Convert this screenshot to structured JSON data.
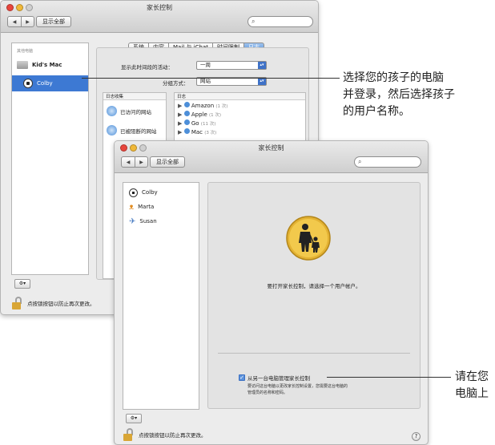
{
  "back_window": {
    "title": "家长控制",
    "show_all": "显示全部",
    "sidebar_header": "其他电脑",
    "sidebar_items": [
      "Kid's Mac",
      "Colby"
    ],
    "tabs": [
      "系统",
      "内容",
      "Mail 与 iChat",
      "时间限制",
      "日志"
    ],
    "active_tab": "日志",
    "show_activity_label": "显示此时间段的活动：",
    "show_activity_value": "一周",
    "group_by_label": "分组方式：",
    "group_by_value": "网站",
    "log_collections_header": "日志收集",
    "log_collections": [
      "已访问的网站",
      "已被阻断的网站"
    ],
    "logs_header": "日志",
    "logs": [
      {
        "name": "Amazon",
        "count": "(1 次)"
      },
      {
        "name": "Apple",
        "count": "(1 次)"
      },
      {
        "name": "Go",
        "count": "(11 次)"
      },
      {
        "name": "Mac",
        "count": "(3 次)"
      }
    ],
    "lock_text": "点按锁按钮以防止再次更改。"
  },
  "front_window": {
    "title": "家长控制",
    "show_all": "显示全部",
    "users": [
      "Colby",
      "Marta",
      "Susan"
    ],
    "message": "要打开家长控制，请选择一个用户帐户。",
    "checkbox_label": "从另一台电脑管理家长控制",
    "checkbox_checked": true,
    "checkbox_desc_1": "要访问这台电脑以更改家长控制设置，您需要这台电脑的",
    "checkbox_desc_2": "管理员的名称和密码。",
    "lock_text": "点按锁按钮以防止再次更改。",
    "help": "?"
  },
  "callouts": {
    "top": [
      "选择您的孩子的电脑",
      "并登录，然后选择孩子",
      "的用户名称。"
    ],
    "bottom": [
      "请在您",
      "电脑上"
    ]
  }
}
